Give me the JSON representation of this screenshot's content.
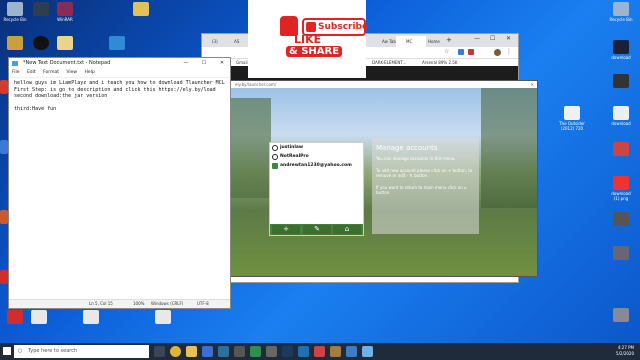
{
  "desktop_icons_left": [
    {
      "label": "Recycle Bin",
      "color": "#9db4cf"
    },
    {
      "label": "WinRAR",
      "color": "#8a2a55"
    },
    {
      "label": "",
      "color": "#c9a03a"
    },
    {
      "label": "",
      "color": "#2f8bd8"
    },
    {
      "label": "",
      "color": "#d33b2b"
    },
    {
      "label": "",
      "color": "#3a7bd5"
    },
    {
      "label": "",
      "color": "#ce5a2b"
    },
    {
      "label": "",
      "color": "#d22d2d"
    }
  ],
  "desktop_icons_right": [
    {
      "label": "Recycle Bin"
    },
    {
      "label": "download"
    },
    {
      "label": ""
    },
    {
      "label": "The Outsider (2012) 720"
    },
    {
      "label": "download"
    },
    {
      "label": ""
    },
    {
      "label": "download (1).png"
    },
    {
      "label": ""
    },
    {
      "label": ""
    },
    {
      "label": ""
    }
  ],
  "notepad": {
    "title": "*New Text Document.txt - Notepad",
    "menu": [
      "File",
      "Edit",
      "Format",
      "View",
      "Help"
    ],
    "content": "hellow guys im LiamPlayz and i teach you how to download Tlauncher MCL\nFirst Step: is go to description and click this https://ely.by/load\nsecond download:the jar version\n\nthird:Have fun",
    "status_position": "Ln 5, Col 15",
    "status_zoom": "100%",
    "status_eol": "Windows (CRLF)",
    "status_encoding": "UTF-8",
    "minimize": "—",
    "maximize": "☐",
    "close": "✕"
  },
  "browser": {
    "tabs": [
      "(3)",
      "AS",
      "ly",
      "Aw Tab",
      "MC",
      "Home"
    ],
    "bookmarks": [
      "Gmail",
      "DARK-ELEMENT...",
      "Arsenal 89% 2.5K"
    ]
  },
  "launcher": {
    "title": "ely.by/launcher.com/",
    "accounts": [
      "justinlaw",
      "NotRealPro",
      "andrewtan1230@yahoo.com"
    ],
    "manage_title": "Manage accounts",
    "manage_p1": "You can manage accounts in this menu.",
    "manage_p2": "To add new account please click on + button, to remove or edit - ✎ button.",
    "manage_p3": "If you want to return to main menu click on ⌂ button."
  },
  "overlay": {
    "subscribe": "Subscribe",
    "like": "LIKE",
    "share": "& SHARE"
  },
  "taskbar": {
    "search_placeholder": "Type here to search",
    "time": "4:27 PM",
    "date": "5/2/2020"
  },
  "colors": {
    "accent": "#0b5bd6",
    "subscribe": "#e02424"
  }
}
